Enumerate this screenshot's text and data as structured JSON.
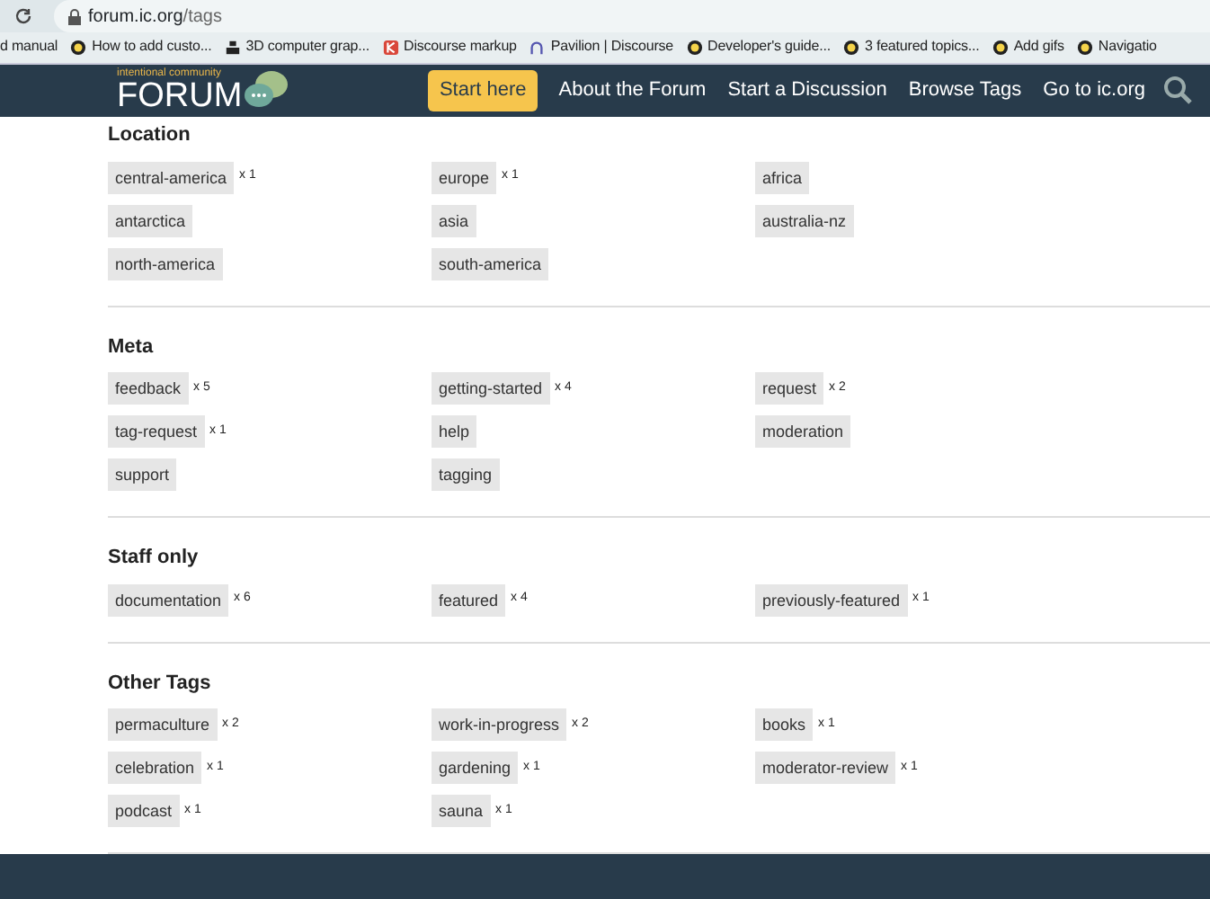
{
  "browser": {
    "url_host": "forum.ic.org",
    "url_path": "/tags",
    "bookmarks": [
      {
        "label": "d manual",
        "kind": "plain"
      },
      {
        "label": "How to add custo...",
        "kind": "bubble"
      },
      {
        "label": "3D computer grap...",
        "kind": "block"
      },
      {
        "label": "Discourse markup",
        "kind": "letter"
      },
      {
        "label": "Pavilion | Discourse",
        "kind": "arch"
      },
      {
        "label": "Developer's guide...",
        "kind": "bubble"
      },
      {
        "label": "3 featured topics...",
        "kind": "bubble"
      },
      {
        "label": "Add gifs",
        "kind": "bubble"
      },
      {
        "label": "Navigatio",
        "kind": "bubble"
      }
    ]
  },
  "header": {
    "logo_small": "intentional community",
    "logo_text": "FORUM",
    "nav": [
      {
        "label": "Start here",
        "kind": "primary"
      },
      {
        "label": "About the Forum",
        "kind": "link"
      },
      {
        "label": "Start a Discussion",
        "kind": "link"
      },
      {
        "label": "Browse Tags",
        "kind": "link"
      },
      {
        "label": "Go to ic.org",
        "kind": "link"
      }
    ]
  },
  "sections": [
    {
      "title": "Location",
      "tags": [
        {
          "name": "central-america",
          "count": "x 1"
        },
        {
          "name": "europe",
          "count": "x 1"
        },
        {
          "name": "africa"
        },
        {
          "name": "antarctica"
        },
        {
          "name": "asia"
        },
        {
          "name": "australia-nz"
        },
        {
          "name": "north-america"
        },
        {
          "name": "south-america"
        }
      ]
    },
    {
      "title": "Meta",
      "tags": [
        {
          "name": "feedback",
          "count": "x 5"
        },
        {
          "name": "getting-started",
          "count": "x 4"
        },
        {
          "name": "request",
          "count": "x 2"
        },
        {
          "name": "tag-request",
          "count": "x 1"
        },
        {
          "name": "help"
        },
        {
          "name": "moderation"
        },
        {
          "name": "support"
        },
        {
          "name": "tagging"
        }
      ]
    },
    {
      "title": "Staff only",
      "tags": [
        {
          "name": "documentation",
          "count": "x 6"
        },
        {
          "name": "featured",
          "count": "x 4"
        },
        {
          "name": "previously-featured",
          "count": "x 1"
        }
      ]
    },
    {
      "title": "Other Tags",
      "tags": [
        {
          "name": "permaculture",
          "count": "x 2"
        },
        {
          "name": "work-in-progress",
          "count": "x 2"
        },
        {
          "name": "books",
          "count": "x 1"
        },
        {
          "name": "celebration",
          "count": "x 1"
        },
        {
          "name": "gardening",
          "count": "x 1"
        },
        {
          "name": "moderator-review",
          "count": "x 1"
        },
        {
          "name": "podcast",
          "count": "x 1"
        },
        {
          "name": "sauna",
          "count": "x 1"
        }
      ]
    }
  ]
}
